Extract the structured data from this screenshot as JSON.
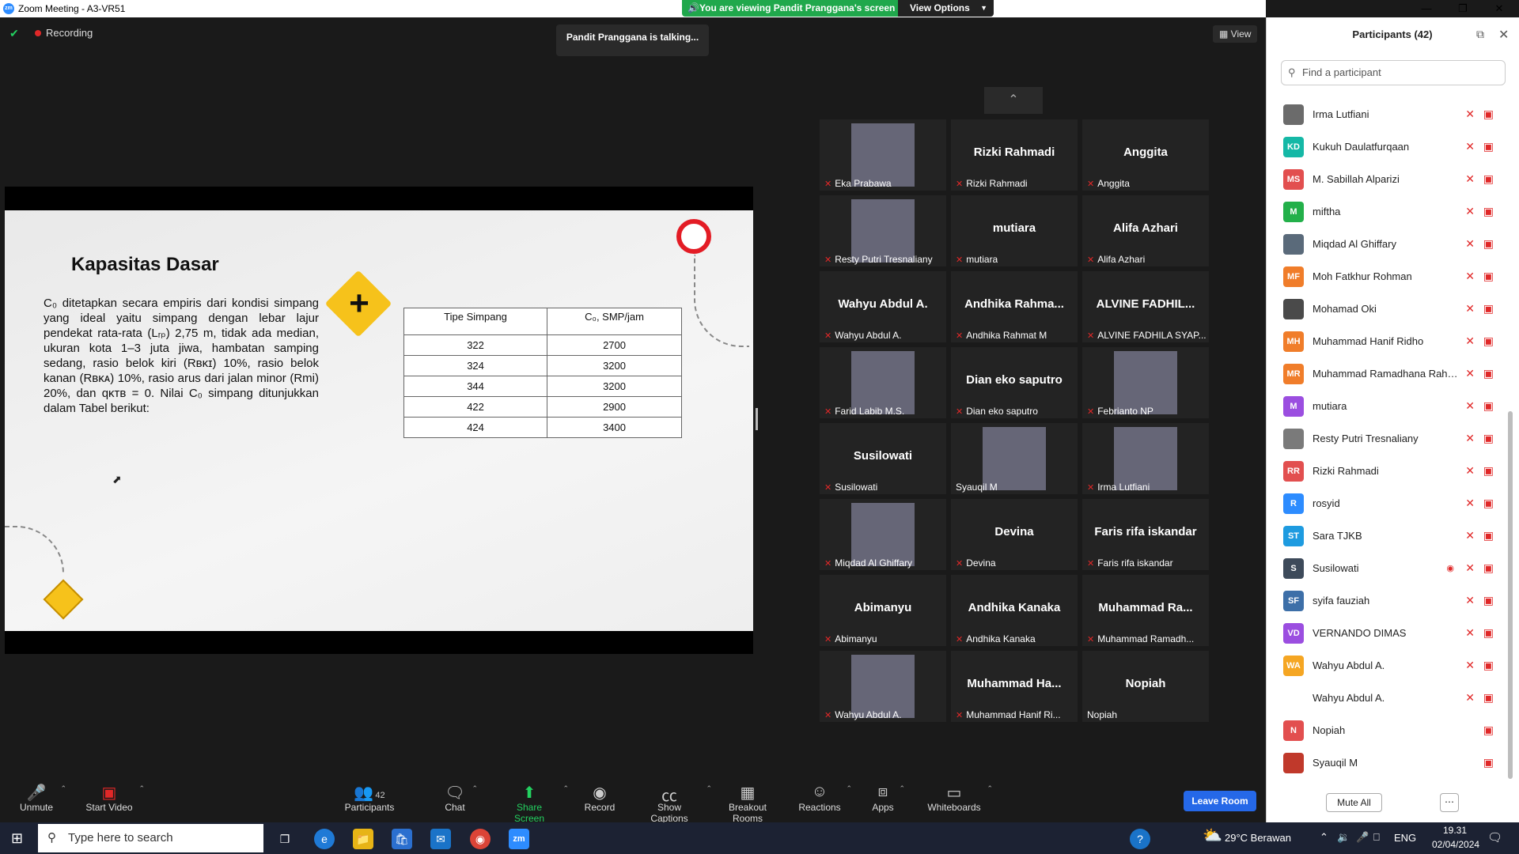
{
  "window": {
    "title": "Zoom Meeting - A3-VR51",
    "app_icon": "zm"
  },
  "banner": {
    "viewing": "You are viewing Pandit Pranggana's screen",
    "view_options": "View Options"
  },
  "meeting": {
    "recording": "Recording",
    "talking": "Pandit Pranggana is talking...",
    "view_label": "View"
  },
  "slide": {
    "title": "Kapasitas Dasar",
    "body": "C₀ ditetapkan secara empiris dari kondisi simpang yang ideal yaitu simpang dengan lebar lajur pendekat rata-rata (Lᵣₚ) 2,75 m, tidak ada median, ukuran kota 1–3 juta jiwa, hambatan samping sedang, rasio belok kiri (Rʙᴋɪ) 10%, rasio belok kanan (Rʙᴋᴀ) 10%, rasio arus dari jalan minor (Rmi) 20%, dan qᴋᴛʙ = 0. Nilai C₀ simpang ditunjukkan dalam Tabel berikut:",
    "table": {
      "headers": [
        "Tipe Simpang",
        "C₀, SMP/jam"
      ],
      "rows": [
        [
          "322",
          "2700"
        ],
        [
          "324",
          "3200"
        ],
        [
          "344",
          "3200"
        ],
        [
          "422",
          "2900"
        ],
        [
          "424",
          "3400"
        ]
      ]
    }
  },
  "gallery": [
    {
      "name": "",
      "caption": "Eka Prabawa",
      "photo": true
    },
    {
      "name": "Rizki Rahmadi",
      "caption": "Rizki Rahmadi"
    },
    {
      "name": "Anggita",
      "caption": "Anggita"
    },
    {
      "name": "",
      "caption": "Resty Putri Tresnaliany",
      "photo": true
    },
    {
      "name": "mutiara",
      "caption": "mutiara"
    },
    {
      "name": "Alifa Azhari",
      "caption": "Alifa Azhari"
    },
    {
      "name": "Wahyu Abdul A.",
      "caption": "Wahyu Abdul A."
    },
    {
      "name": "Andhika  Rahma...",
      "caption": "Andhika Rahmat M"
    },
    {
      "name": "ALVINE FADHIL...",
      "caption": "ALVINE FADHILA SYAP..."
    },
    {
      "name": "",
      "caption": "Farid Labib M.S.",
      "photo": true
    },
    {
      "name": "Dian eko saputro",
      "caption": "Dian eko saputro"
    },
    {
      "name": "",
      "caption": "Febrianto NP",
      "photo": true
    },
    {
      "name": "Susilowati",
      "caption": "Susilowati"
    },
    {
      "name": "",
      "caption": "Syauqil M",
      "photo": true,
      "nomic": true
    },
    {
      "name": "",
      "caption": "Irma Lutfiani",
      "photo": true
    },
    {
      "name": "",
      "caption": "Miqdad Al Ghiffary",
      "photo": true
    },
    {
      "name": "Devina",
      "caption": "Devina"
    },
    {
      "name": "Faris rifa iskandar",
      "caption": "Faris rifa iskandar"
    },
    {
      "name": "Abimanyu",
      "caption": "Abimanyu"
    },
    {
      "name": "Andhika Kanaka",
      "caption": "Andhika Kanaka"
    },
    {
      "name": "Muhammad  Ra...",
      "caption": "Muhammad Ramadh..."
    },
    {
      "name": "",
      "caption": "Wahyu Abdul A.",
      "photo": true
    },
    {
      "name": "Muhammad  Ha...",
      "caption": "Muhammad Hanif Ri..."
    },
    {
      "name": "Nopiah",
      "caption": "Nopiah",
      "nomic": true
    }
  ],
  "toolbar": {
    "unmute": "Unmute",
    "start_video": "Start Video",
    "participants": "Participants",
    "participants_count": "42",
    "chat": "Chat",
    "share_screen": "Share Screen",
    "record": "Record",
    "show_captions": "Show Captions",
    "breakout_rooms": "Breakout Rooms",
    "reactions": "Reactions",
    "apps": "Apps",
    "whiteboards": "Whiteboards",
    "leave": "Leave Room"
  },
  "panel": {
    "title": "Participants (42)",
    "search_placeholder": "Find a participant",
    "mute_all": "Mute All",
    "participants": [
      {
        "initials": "",
        "name": "Irma Lutfiani",
        "color": "#6b6b6b"
      },
      {
        "initials": "KD",
        "name": "Kukuh Daulatfurqaan",
        "color": "#15b8a6"
      },
      {
        "initials": "MS",
        "name": "M. Sabillah Alparizi",
        "color": "#e24f4f"
      },
      {
        "initials": "M",
        "name": "miftha",
        "color": "#23b04a"
      },
      {
        "initials": "",
        "name": "Miqdad Al Ghiffary",
        "color": "#5a6a7a"
      },
      {
        "initials": "MF",
        "name": "Moh Fatkhur Rohman",
        "color": "#f07d2a"
      },
      {
        "initials": "",
        "name": "Mohamad Oki",
        "color": "#4a4a4a"
      },
      {
        "initials": "MH",
        "name": "Muhammad Hanif Ridho",
        "color": "#f07d2a"
      },
      {
        "initials": "MR",
        "name": "Muhammad Ramadhana Rahm...",
        "color": "#f07d2a"
      },
      {
        "initials": "M",
        "name": "mutiara",
        "color": "#9b4ee0"
      },
      {
        "initials": "",
        "name": "Resty Putri Tresnaliany",
        "color": "#7a7a7a"
      },
      {
        "initials": "RR",
        "name": "Rizki Rahmadi",
        "color": "#e24f4f"
      },
      {
        "initials": "R",
        "name": "rosyid",
        "color": "#2d8cff"
      },
      {
        "initials": "ST",
        "name": "Sara TJKB",
        "color": "#1e9be0"
      },
      {
        "initials": "S",
        "name": "Susilowati",
        "color": "#3d4a5a"
      },
      {
        "initials": "SF",
        "name": "syifa fauziah",
        "color": "#3d6fa8"
      },
      {
        "initials": "VD",
        "name": "VERNANDO DIMAS",
        "color": "#9b4ee0"
      },
      {
        "initials": "WA",
        "name": "Wahyu Abdul A.",
        "color": "#f5a623"
      },
      {
        "initials": "",
        "name": "Wahyu Abdul A.",
        "color": "#ffffff"
      },
      {
        "initials": "N",
        "name": "Nopiah",
        "color": "#e24f4f"
      },
      {
        "initials": "",
        "name": "Syauqil M",
        "color": "#c0392b"
      }
    ]
  },
  "taskbar": {
    "search_placeholder": "Type here to search",
    "weather": "29°C  Berawan",
    "lang": "ENG",
    "time": "19.31",
    "date": "02/04/2024"
  }
}
